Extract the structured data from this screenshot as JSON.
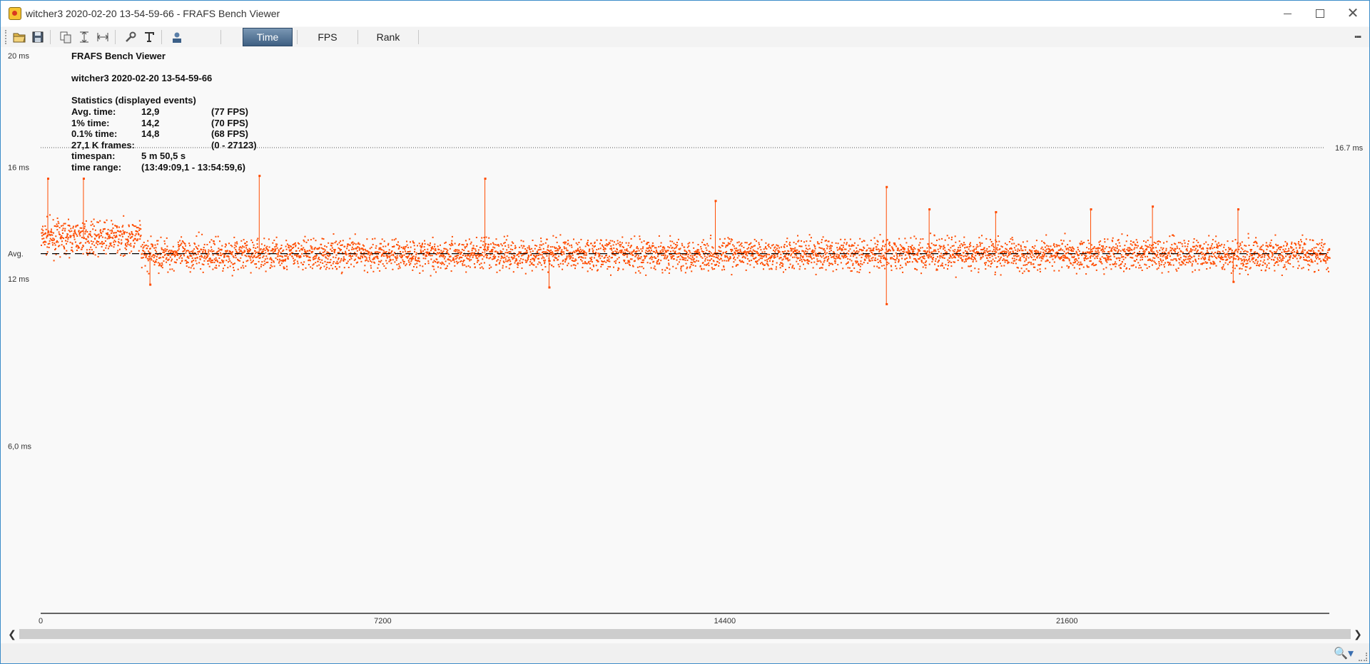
{
  "window": {
    "title": "witcher3 2020-02-20 13-54-59-66 - FRAFS Bench Viewer"
  },
  "toolbar": {
    "icons": [
      "open-folder-icon",
      "save-icon",
      "copy-icon",
      "fit-vertical-icon",
      "fit-horizontal-icon",
      "wrench-icon",
      "text-icon",
      "user-icon"
    ],
    "tabs": [
      {
        "label": "Time",
        "active": true
      },
      {
        "label": "FPS",
        "active": false
      },
      {
        "label": "Rank",
        "active": false
      }
    ]
  },
  "stats": {
    "app_name": "FRAFS Bench Viewer",
    "file_name": "witcher3 2020-02-20 13-54-59-66",
    "heading": "Statistics (displayed events)",
    "rows": [
      {
        "label": "Avg. time:",
        "value": "12,9",
        "extra": "(77 FPS)"
      },
      {
        "label": "1% time:",
        "value": "14,2",
        "extra": "(70 FPS)"
      },
      {
        "label": "0.1% time:",
        "value": "14,8",
        "extra": "(68 FPS)"
      },
      {
        "label": "27,1 K frames:",
        "value": "",
        "extra": "(0 - 27123)"
      },
      {
        "label": "timespan:",
        "value": "5 m 50,5 s",
        "extra": ""
      },
      {
        "label": "time range:",
        "value": "(13:49:09,1 - 13:54:59,6)",
        "extra": ""
      }
    ]
  },
  "chart_data": {
    "type": "scatter",
    "title": "",
    "xlabel": "",
    "ylabel": "",
    "y_ticks": [
      {
        "label": "20 ms",
        "value": 20
      },
      {
        "label": "16 ms",
        "value": 16
      },
      {
        "label": "Avg.",
        "value": 12.9
      },
      {
        "label": "12 ms",
        "value": 12
      },
      {
        "label": "6,0 ms",
        "value": 6
      }
    ],
    "x_ticks": [
      0,
      7200,
      14400,
      21600
    ],
    "xlim": [
      0,
      27123
    ],
    "ylim": [
      0,
      21
    ],
    "reference_line": {
      "label": "16.7 ms",
      "value": 16.7
    },
    "avg_line": 12.9,
    "series_color": "#ff4c00",
    "segments": [
      {
        "x_start": 0,
        "x_end": 2100,
        "mean": 13.5,
        "spread": 0.6
      },
      {
        "x_start": 2100,
        "x_end": 27123,
        "mean": 12.9,
        "spread": 0.6
      }
    ],
    "spikes": [
      {
        "x": 150,
        "y": 15.6
      },
      {
        "x": 900,
        "y": 15.6
      },
      {
        "x": 4600,
        "y": 15.7
      },
      {
        "x": 9350,
        "y": 15.6
      },
      {
        "x": 14200,
        "y": 14.8
      },
      {
        "x": 17800,
        "y": 15.3
      },
      {
        "x": 18700,
        "y": 14.5
      },
      {
        "x": 20100,
        "y": 14.4
      },
      {
        "x": 22100,
        "y": 14.5
      },
      {
        "x": 23400,
        "y": 14.6
      },
      {
        "x": 25200,
        "y": 14.5
      }
    ],
    "dips": [
      {
        "x": 2300,
        "y": 11.8
      },
      {
        "x": 10700,
        "y": 11.7
      },
      {
        "x": 17800,
        "y": 11.1
      },
      {
        "x": 25100,
        "y": 11.9
      }
    ]
  }
}
